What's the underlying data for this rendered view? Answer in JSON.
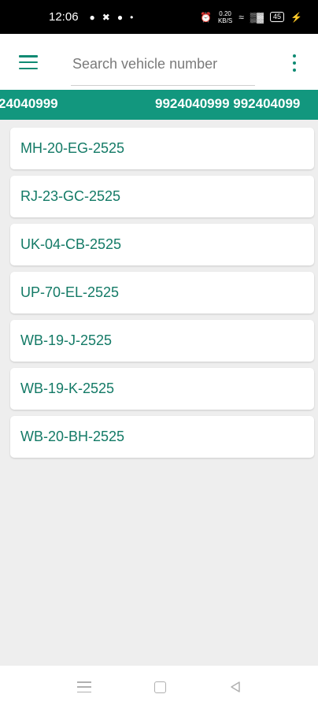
{
  "status_bar": {
    "time": "12:06",
    "net_speed_value": "0.20",
    "net_speed_unit": "KB/S",
    "battery": "45"
  },
  "app_bar": {
    "search_placeholder": "Search vehicle number",
    "search_value": ""
  },
  "ticker": {
    "segments": [
      "24040999",
      "9924040999 992404099"
    ]
  },
  "vehicles": [
    {
      "number": "MH-20-EG-2525"
    },
    {
      "number": "RJ-23-GC-2525"
    },
    {
      "number": "UK-04-CB-2525"
    },
    {
      "number": "UP-70-EL-2525"
    },
    {
      "number": "WB-19-J-2525"
    },
    {
      "number": "WB-19-K-2525"
    },
    {
      "number": "WB-20-BH-2525"
    }
  ],
  "colors": {
    "accent": "#12977e",
    "vehicle_text": "#137a66",
    "background": "#eeeeee"
  },
  "icons": {
    "menu": "hamburger-menu-icon",
    "more": "more-vertical-icon",
    "nav_recent": "recent-apps-icon",
    "nav_home": "home-icon",
    "nav_back": "back-icon"
  }
}
